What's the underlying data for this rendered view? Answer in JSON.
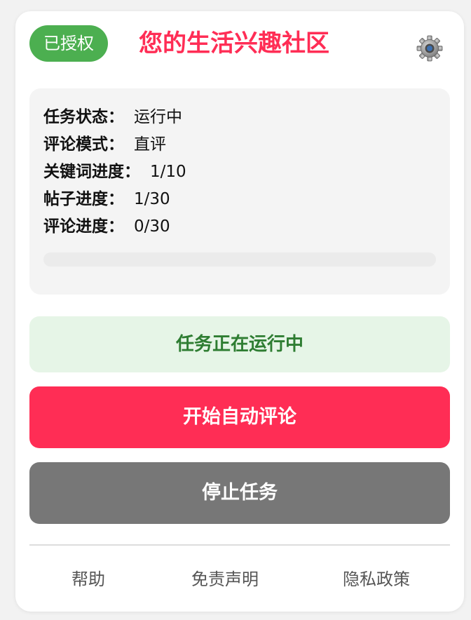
{
  "header": {
    "auth_badge": "已授权",
    "title": "您的生活兴趣社区",
    "settings_icon": "gear-icon"
  },
  "status": {
    "rows": [
      {
        "label": "任务状态：",
        "value": "运行中"
      },
      {
        "label": "评论模式：",
        "value": "直评"
      },
      {
        "label": "关键词进度：",
        "value": "1/10"
      },
      {
        "label": "帖子进度：",
        "value": "1/30"
      },
      {
        "label": "评论进度：",
        "value": "0/30"
      }
    ],
    "progress_percent": 0
  },
  "banner": {
    "text": "任务正在运行中"
  },
  "buttons": {
    "start": "开始自动评论",
    "stop": "停止任务"
  },
  "footer": {
    "help": "帮助",
    "disclaimer": "免责声明",
    "privacy": "隐私政策"
  },
  "colors": {
    "accent": "#ff2d55",
    "auth_green": "#4caf50",
    "banner_bg": "#e6f5e7",
    "banner_text": "#2e7d32",
    "stop_gray": "#777777"
  }
}
